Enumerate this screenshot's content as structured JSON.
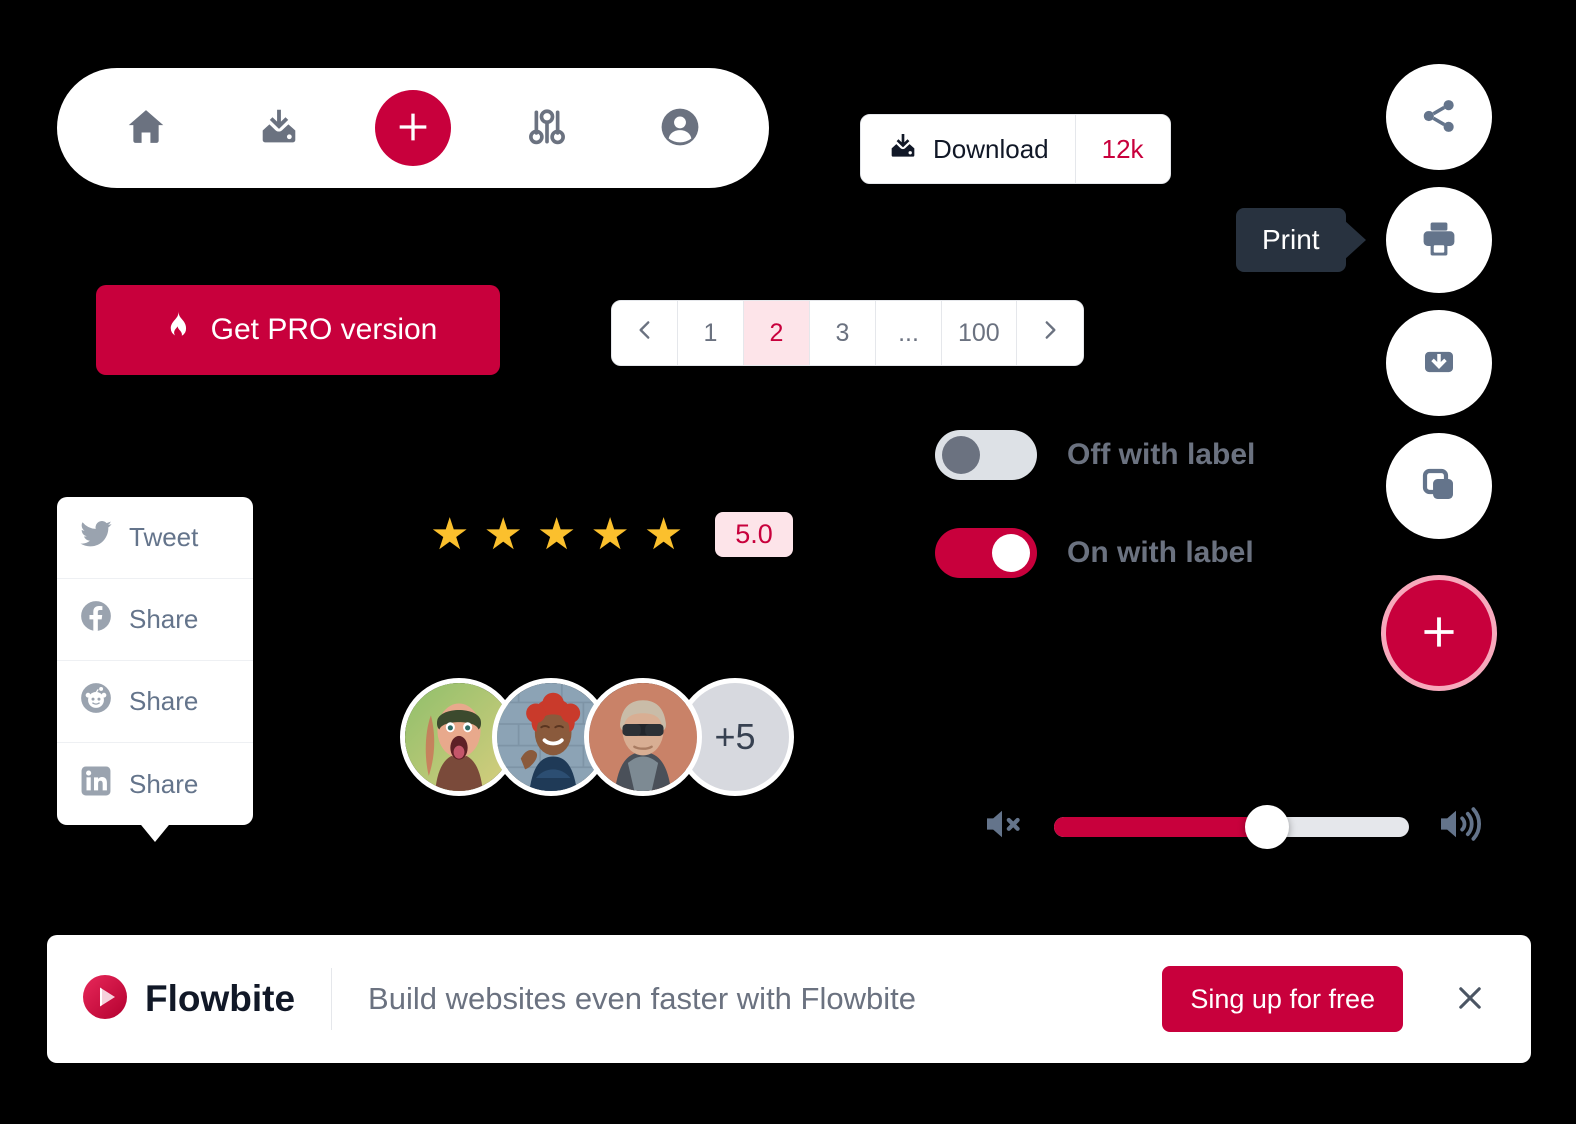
{
  "brand": {
    "primary_color": "#C8003C",
    "primary_light": "#FDE4E9",
    "grey": "#6B7280",
    "tooltip_bg": "#28323F",
    "star_color": "#FBC02D"
  },
  "bottom_nav": {
    "items": [
      {
        "icon": "home-icon",
        "label": "Home"
      },
      {
        "icon": "download-inbox-icon",
        "label": "Download"
      },
      {
        "icon": "plus-icon",
        "label": "Add new"
      },
      {
        "icon": "adjustments-icon",
        "label": "Settings"
      },
      {
        "icon": "user-circle-icon",
        "label": "Profile"
      }
    ]
  },
  "get_pro": {
    "label": "Get PRO version",
    "icon": "fire-icon"
  },
  "download_button": {
    "label": "Download",
    "count": "12k",
    "icon": "download-inbox-icon"
  },
  "pagination": {
    "prev_icon": "chevron-left-icon",
    "next_icon": "chevron-right-icon",
    "pages": [
      "1",
      "2",
      "3",
      "...",
      "100"
    ],
    "active_page": "2"
  },
  "share_dropdown": {
    "items": [
      {
        "icon": "twitter-icon",
        "label": "Tweet"
      },
      {
        "icon": "facebook-icon",
        "label": "Share"
      },
      {
        "icon": "reddit-icon",
        "label": "Share"
      },
      {
        "icon": "linkedin-icon",
        "label": "Share"
      }
    ]
  },
  "rating": {
    "stars_filled": 5,
    "star_glyph": "★",
    "score": "5.0"
  },
  "avatars": {
    "more_label": "+5",
    "people": [
      {
        "name": "avatar-person-1"
      },
      {
        "name": "avatar-person-2"
      },
      {
        "name": "avatar-person-3"
      }
    ]
  },
  "toggles": [
    {
      "state": "off",
      "label": "Off with label"
    },
    {
      "state": "on",
      "label": "On with label"
    }
  ],
  "action_buttons": [
    {
      "icon": "share-nodes-icon",
      "label": "Share"
    },
    {
      "icon": "printer-icon",
      "label": "Print"
    },
    {
      "icon": "save-download-icon",
      "label": "Save"
    },
    {
      "icon": "copy-icon",
      "label": "Copy"
    }
  ],
  "fab": {
    "icon": "plus-icon",
    "label": "Add"
  },
  "tooltip": {
    "text": "Print"
  },
  "volume": {
    "value": 60,
    "mute_icon": "volume-mute-icon",
    "up_icon": "volume-up-icon"
  },
  "banner": {
    "brand": "Flowbite",
    "logo_icon": "flowbite-play-icon",
    "message": "Build websites even faster with Flowbite",
    "cta_label": "Sing up for free",
    "close_icon": "close-icon"
  }
}
